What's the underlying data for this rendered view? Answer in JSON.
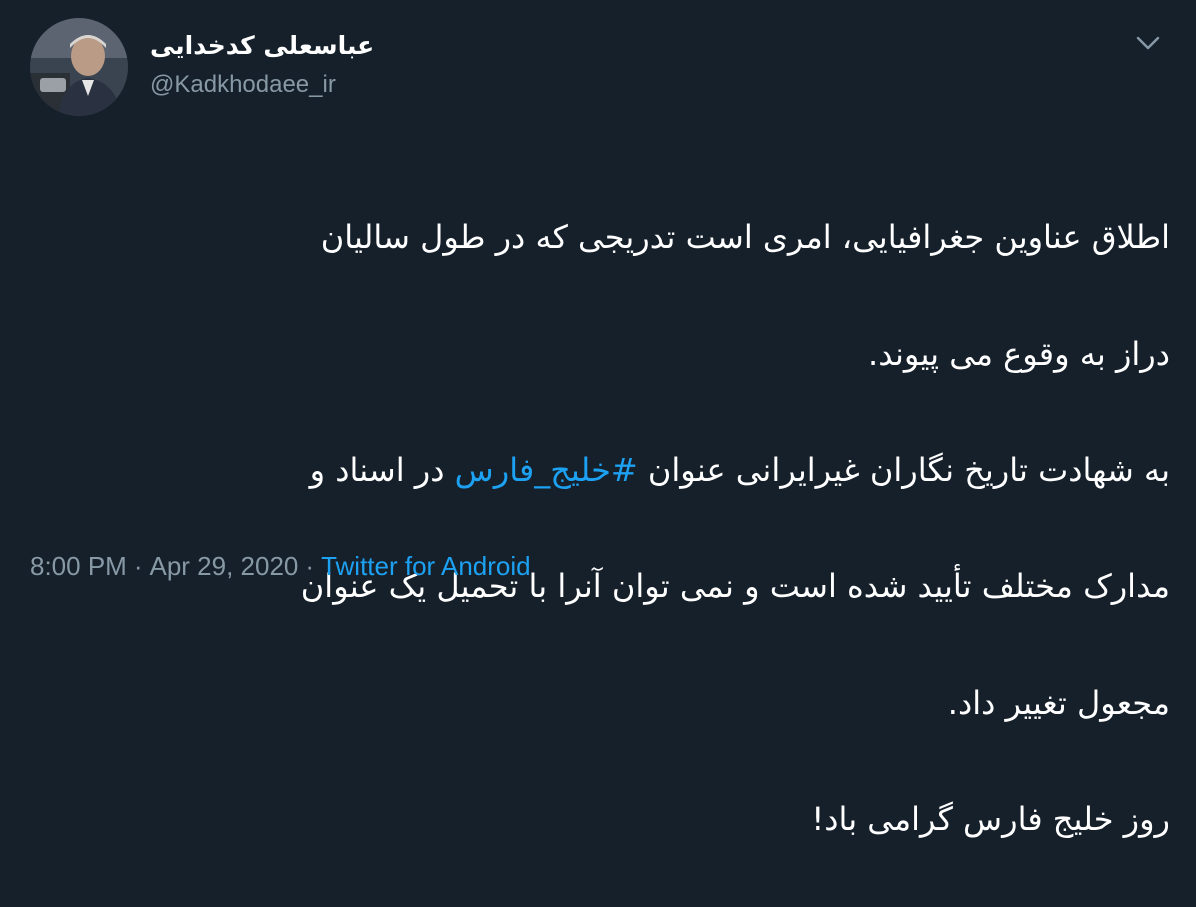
{
  "author": {
    "display_name": "عباسعلی کدخدایی",
    "handle": "@Kadkhodaee_ir",
    "avatar_icon": "profile-photo"
  },
  "tweet": {
    "lines": [
      {
        "text": "اطلاق عناوین جغرافیایی، امری است تدریجی که در طول سالیان"
      },
      {
        "text": "دراز به وقوع می پیوند."
      },
      {
        "before": "به شهادت تاریخ نگاران غیرایرانی عنوان ",
        "hashtag": "#خلیج_فارس",
        "after": " در اسناد و"
      },
      {
        "text": "مدارک مختلف تأیید شده است و نمی توان آنرا با تحمیل یک عنوان"
      },
      {
        "text": "مجعول تغییر داد."
      },
      {
        "text": "روز خلیج فارس گرامی باد!"
      }
    ]
  },
  "meta": {
    "time": "8:00 PM",
    "separator": "·",
    "date": "Apr 29, 2020",
    "source": "Twitter for Android"
  },
  "colors": {
    "background": "#15202b",
    "text": "#ffffff",
    "secondary": "#8899a6",
    "link": "#1da1f2"
  },
  "icons": {
    "menu": "chevron-down-icon"
  }
}
